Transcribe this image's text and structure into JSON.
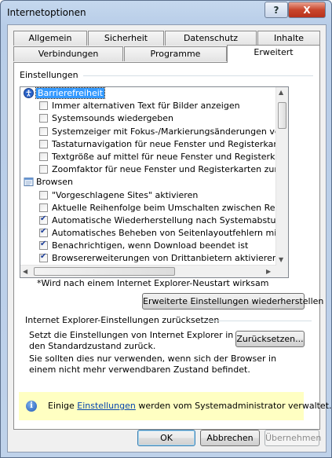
{
  "window": {
    "title": "Internetoptionen",
    "help_glyph": "?",
    "close_glyph": "X"
  },
  "tabs": {
    "row1": [
      "Allgemein",
      "Sicherheit",
      "Datenschutz",
      "Inhalte"
    ],
    "row2": [
      "Verbindungen",
      "Programme",
      "Erweitert"
    ],
    "active": "Erweitert"
  },
  "settings": {
    "group_label": "Einstellungen",
    "items": [
      {
        "type": "category",
        "label": "Barrierefreiheit",
        "icon": "accessibility-icon",
        "selected": true
      },
      {
        "type": "checkbox",
        "label": "Immer alternativen Text für Bilder anzeigen",
        "checked": false
      },
      {
        "type": "checkbox",
        "label": "Systemsounds wiedergeben",
        "checked": false
      },
      {
        "type": "checkbox",
        "label": "Systemzeiger mit Fokus-/Markierungsänderungen verschieben",
        "checked": false
      },
      {
        "type": "checkbox",
        "label": "Tastaturnavigation für neue Fenster und Registerkarten aktivieren",
        "checked": false
      },
      {
        "type": "checkbox",
        "label": "Textgröße auf mittel für neue Fenster und Registerkarten zurücksetzen",
        "checked": false
      },
      {
        "type": "checkbox",
        "label": "Zoomfaktor für neue Fenster und Registerkarten zurücksetzen",
        "checked": false
      },
      {
        "type": "category",
        "label": "Browsen",
        "icon": "page-icon",
        "selected": false
      },
      {
        "type": "checkbox",
        "label": "\"Vorgeschlagene Sites\" aktivieren",
        "checked": false
      },
      {
        "type": "checkbox",
        "label": "Aktuelle Reihenfolge beim Umschalten zwischen Registerkarten verwenden",
        "checked": false
      },
      {
        "type": "checkbox",
        "label": "Automatische Wiederherstellung nach Systemabsturz aktivieren",
        "checked": true
      },
      {
        "type": "checkbox",
        "label": "Automatisches Beheben von Seitenlayoutfehlern mithilfe der Kompatibilitätsansicht",
        "checked": true
      },
      {
        "type": "checkbox",
        "label": "Benachrichtigen, wenn Download beendet ist",
        "checked": true
      },
      {
        "type": "checkbox",
        "label": "Browsererweiterungen von Drittanbietern aktivieren*",
        "checked": true
      }
    ],
    "restart_note": "*Wird nach einem Internet Explorer-Neustart wirksam",
    "restore_button": "Erweiterte Einstellungen wiederherstellen"
  },
  "reset": {
    "group_label": "Internet Explorer-Einstellungen zurücksetzen",
    "description": "Setzt die Einstellungen von Internet Explorer in den Standardzustand zurück.",
    "button": "Zurücksetzen...",
    "warning": "Sie sollten dies nur verwenden, wenn sich der Browser in einem nicht mehr verwendbaren Zustand befindet."
  },
  "info": {
    "icon": "info-icon",
    "prefix": "Einige ",
    "link": "Einstellungen",
    "suffix": " werden vom Systemadministrator verwaltet."
  },
  "footer": {
    "ok": "OK",
    "cancel": "Abbrechen",
    "apply": "Übernehmen"
  }
}
